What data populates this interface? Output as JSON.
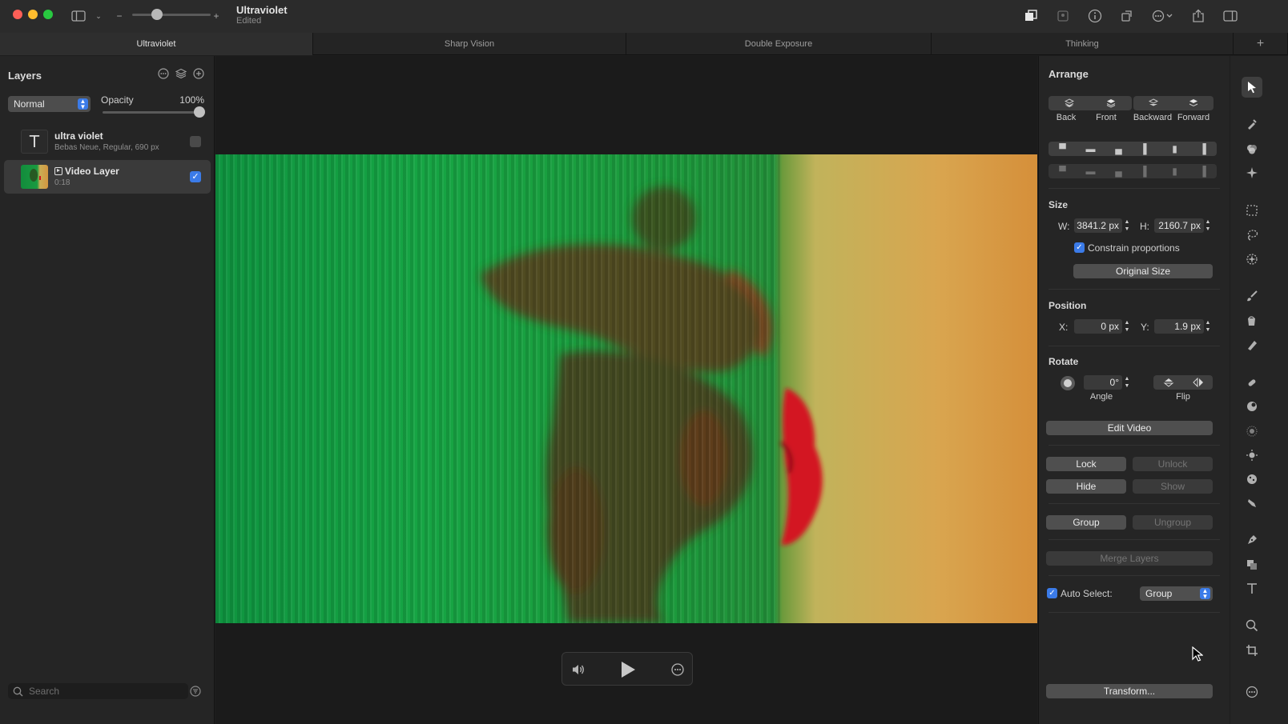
{
  "titlebar": {
    "doc_title": "Ultraviolet",
    "doc_status": "Edited",
    "zoom_minus": "−",
    "zoom_plus": "+"
  },
  "tabs": [
    {
      "label": "Ultraviolet",
      "active": true
    },
    {
      "label": "Sharp Vision",
      "active": false
    },
    {
      "label": "Double Exposure",
      "active": false
    },
    {
      "label": "Thinking",
      "active": false
    }
  ],
  "tab_add": "+",
  "layers_panel": {
    "title": "Layers",
    "blend_mode": "Normal",
    "opacity_label": "Opacity",
    "opacity_value": "100%",
    "opacity_level": 1.0,
    "layers": [
      {
        "name": "ultra violet",
        "meta": "Bebas Neue, Regular, 690 px",
        "type": "text",
        "thumb_glyph": "T",
        "visible": false,
        "selected": false
      },
      {
        "name": "Video Layer",
        "meta": "0:18",
        "type": "video",
        "visible": true,
        "selected": true
      }
    ],
    "search_placeholder": "Search"
  },
  "arrange": {
    "title": "Arrange",
    "order_buttons": [
      "Back",
      "Front",
      "Backward",
      "Forward"
    ],
    "size_title": "Size",
    "width_label": "W:",
    "width_value": "3841.2 px",
    "height_label": "H:",
    "height_value": "2160.7 px",
    "constrain_label": "Constrain proportions",
    "original_size_label": "Original Size",
    "position_title": "Position",
    "x_label": "X:",
    "x_value": "0 px",
    "y_label": "Y:",
    "y_value": "1.9 px",
    "rotate_title": "Rotate",
    "angle_value": "0°",
    "angle_label": "Angle",
    "flip_label": "Flip",
    "edit_video_label": "Edit Video",
    "lock_label": "Lock",
    "unlock_label": "Unlock",
    "hide_label": "Hide",
    "show_label": "Show",
    "group_label": "Group",
    "ungroup_label": "Ungroup",
    "merge_label": "Merge Layers",
    "auto_select_label": "Auto Select:",
    "auto_select_value": "Group",
    "transform_label": "Transform..."
  },
  "colors": {
    "accent": "#3b7be8",
    "lips": "#d31222"
  }
}
